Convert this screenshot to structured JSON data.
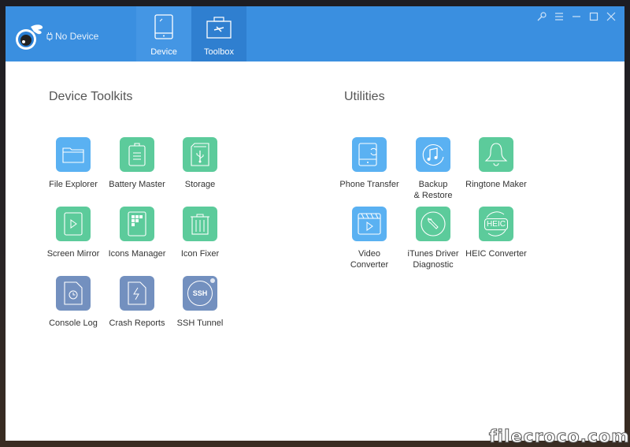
{
  "header": {
    "device_status": "No Device",
    "tabs": [
      {
        "label": "Device",
        "icon": "tablet-icon",
        "active": false
      },
      {
        "label": "Toolbox",
        "icon": "toolbox-icon",
        "active": true
      }
    ],
    "window_controls": [
      "key-icon",
      "menu-icon",
      "minimize-icon",
      "maximize-icon",
      "close-icon"
    ]
  },
  "sections": {
    "device_toolkits": {
      "title": "Device Toolkits",
      "items": [
        {
          "label": "File Explorer",
          "icon": "folder-icon",
          "color": "#5ab1f2"
        },
        {
          "label": "Battery Master",
          "icon": "battery-icon",
          "color": "#5ccb9b"
        },
        {
          "label": "Storage",
          "icon": "usb-storage-icon",
          "color": "#5ccb9b"
        },
        {
          "label": "Screen Mirror",
          "icon": "play-screen-icon",
          "color": "#5ccb9b"
        },
        {
          "label": "Icons Manager",
          "icon": "icons-grid-icon",
          "color": "#5ccb9b"
        },
        {
          "label": "Icon Fixer",
          "icon": "trash-icon",
          "color": "#5ccb9b"
        },
        {
          "label": "Console Log",
          "icon": "clock-file-icon",
          "color": "#7390bf"
        },
        {
          "label": "Crash Reports",
          "icon": "lightning-file-icon",
          "color": "#7390bf"
        },
        {
          "label": "SSH Tunnel",
          "icon": "ssh-icon",
          "color": "#7390bf"
        }
      ]
    },
    "utilities": {
      "title": "Utilities",
      "items": [
        {
          "label": "Phone Transfer",
          "icon": "phone-transfer-icon",
          "color": "#5ab1f2"
        },
        {
          "label": "Backup\n& Restore",
          "icon": "music-backup-icon",
          "color": "#5ab1f2"
        },
        {
          "label": "Ringtone Maker",
          "icon": "bell-icon",
          "color": "#5ccb9b"
        },
        {
          "label": "Video\nConverter",
          "icon": "video-clapper-icon",
          "color": "#5ab1f2"
        },
        {
          "label": "iTunes Driver\nDiagnostic",
          "icon": "wrench-icon",
          "color": "#5ccb9b"
        },
        {
          "label": "HEIC Converter",
          "icon": "heic-icon",
          "color": "#5ccb9b"
        }
      ]
    }
  },
  "ssh_label": "SSH",
  "heic_label": "HEIC",
  "watermark": "filecroco.com"
}
